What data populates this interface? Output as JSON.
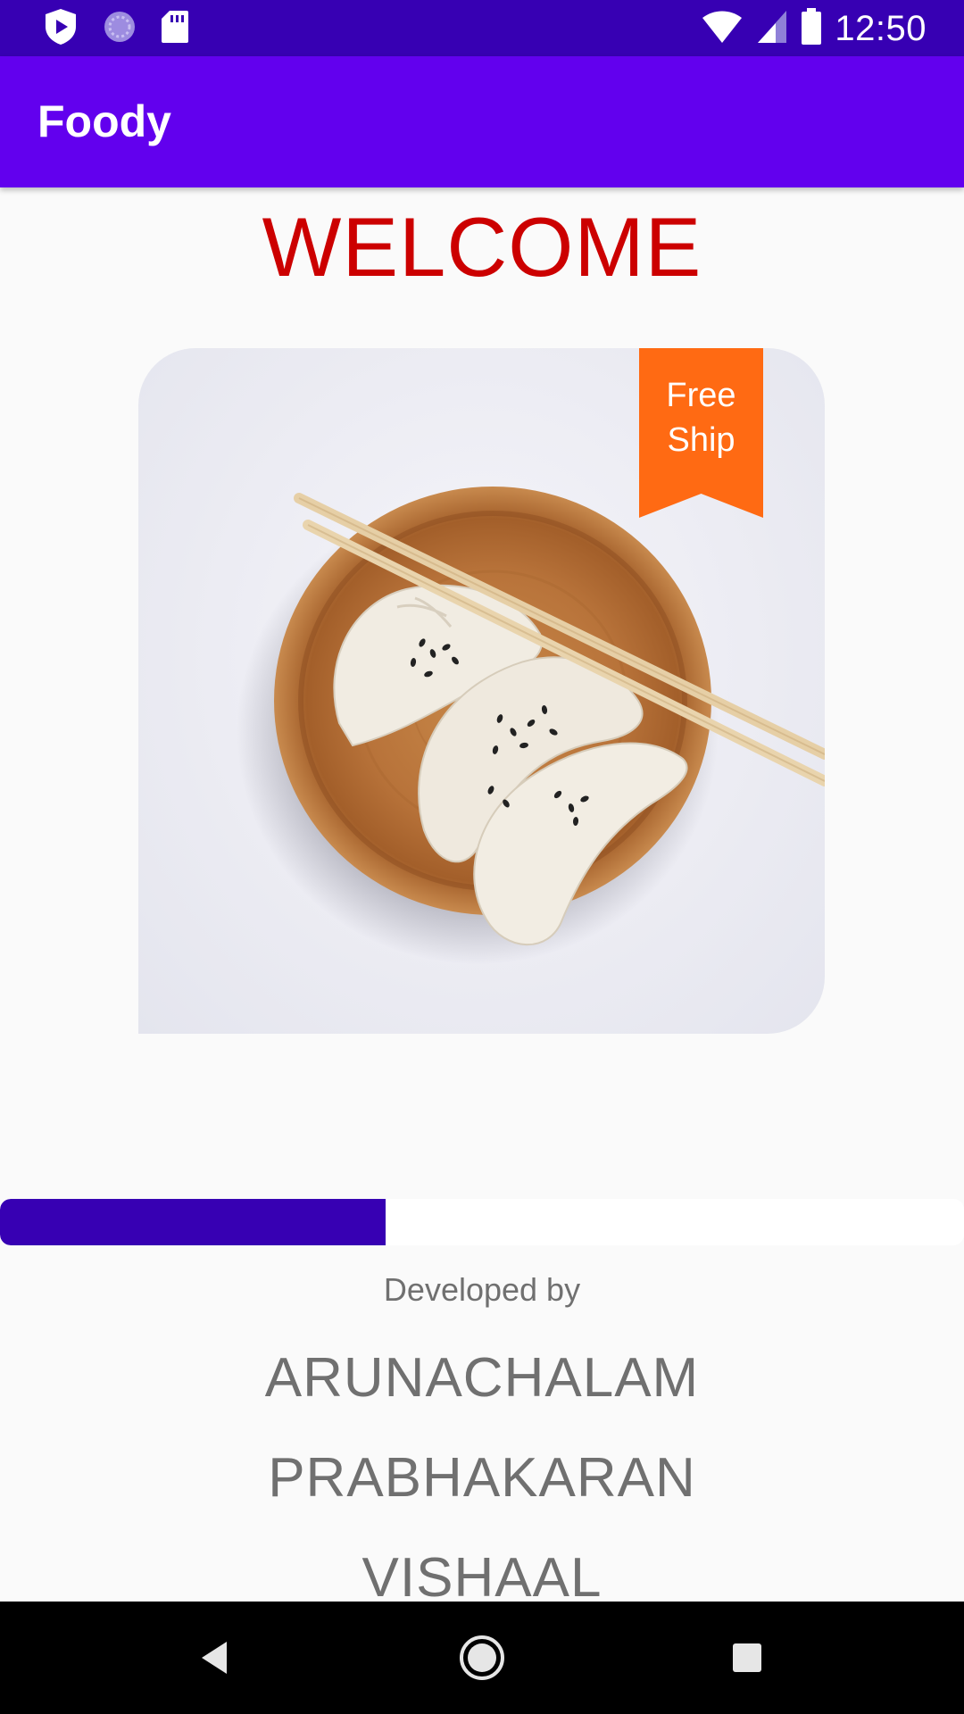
{
  "status_bar": {
    "time": "12:50",
    "icons": [
      "shield-play-icon",
      "loading-circle-icon",
      "sd-card-icon",
      "wifi-icon",
      "cell-signal-icon",
      "battery-icon"
    ]
  },
  "app_bar": {
    "title": "Foody"
  },
  "main": {
    "heading": "WELCOME",
    "heading_color": "#cc0000",
    "image": {
      "subject": "dumplings on a wooden plate with chopsticks",
      "ribbon_text": "Free\nShip",
      "ribbon_color": "#ff6a13"
    },
    "progress": {
      "fraction": 0.4,
      "fill_color": "#3700b3"
    },
    "developer_label": "Developed by",
    "developers": [
      "ARUNACHALAM",
      "PRABHAKARAN",
      "VISHAAL"
    ]
  },
  "nav_bar": {
    "buttons": [
      "back-icon",
      "home-icon",
      "recents-icon"
    ]
  },
  "colors": {
    "status_bar": "#3700b3",
    "app_bar": "#6200ee",
    "background": "#fafafa"
  }
}
